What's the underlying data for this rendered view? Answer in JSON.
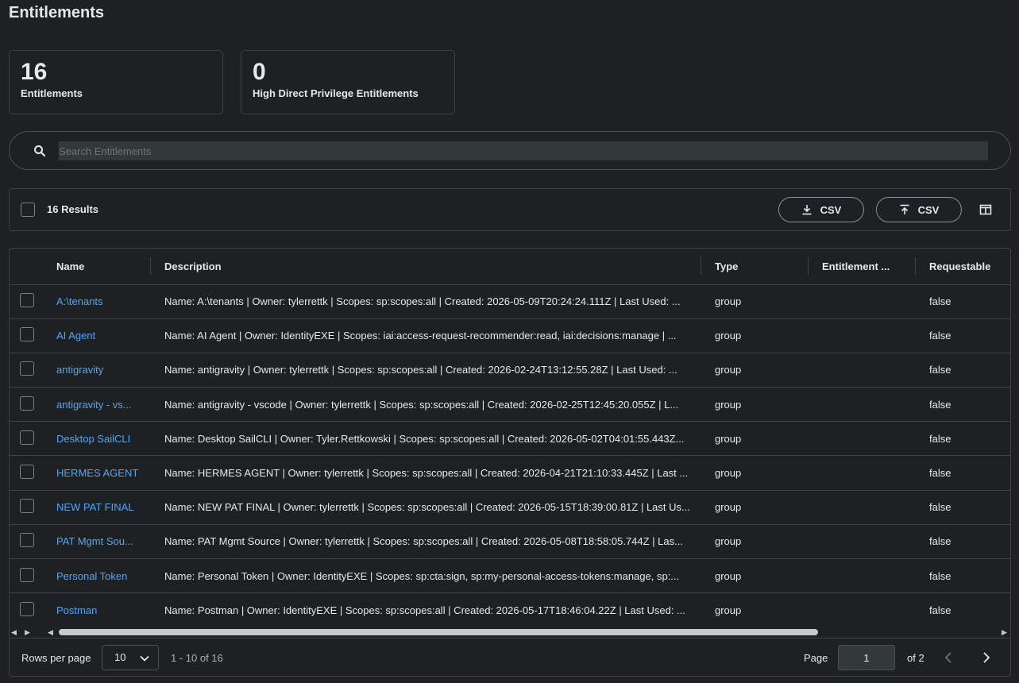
{
  "page": {
    "title": "Entitlements"
  },
  "stats": [
    {
      "value": "16",
      "label": "Entitlements"
    },
    {
      "value": "0",
      "label": "High Direct Privilege Entitlements"
    }
  ],
  "search": {
    "placeholder": "Search Entitlements",
    "value": ""
  },
  "toolbar": {
    "results_label": "16 Results",
    "download_csv_label": "CSV",
    "upload_csv_label": "CSV"
  },
  "table": {
    "columns": [
      "Name",
      "Description",
      "Type",
      "Entitlement ...",
      "Requestable"
    ],
    "rows": [
      {
        "name": "A:\\tenants",
        "description": "Name: A:\\tenants | Owner: tylerrettk | Scopes: sp:scopes:all | Created: 2026-05-09T20:24:24.111Z | Last Used: ...",
        "type": "group",
        "entitlement": "",
        "requestable": "false"
      },
      {
        "name": "AI Agent",
        "description": "Name: AI Agent | Owner: IdentityEXE | Scopes: iai:access-request-recommender:read, iai:decisions:manage | ...",
        "type": "group",
        "entitlement": "",
        "requestable": "false"
      },
      {
        "name": "antigravity",
        "description": "Name: antigravity | Owner: tylerrettk | Scopes: sp:scopes:all | Created: 2026-02-24T13:12:55.28Z | Last Used: ...",
        "type": "group",
        "entitlement": "",
        "requestable": "false"
      },
      {
        "name": "antigravity - vs...",
        "description": "Name: antigravity - vscode | Owner: tylerrettk | Scopes: sp:scopes:all | Created: 2026-02-25T12:45:20.055Z | L...",
        "type": "group",
        "entitlement": "",
        "requestable": "false"
      },
      {
        "name": "Desktop SailCLI",
        "description": "Name: Desktop SailCLI | Owner: Tyler.Rettkowski | Scopes: sp:scopes:all | Created: 2026-05-02T04:01:55.443Z...",
        "type": "group",
        "entitlement": "",
        "requestable": "false"
      },
      {
        "name": "HERMES AGENT",
        "description": "Name: HERMES AGENT | Owner: tylerrettk | Scopes: sp:scopes:all | Created: 2026-04-21T21:10:33.445Z | Last ...",
        "type": "group",
        "entitlement": "",
        "requestable": "false"
      },
      {
        "name": "NEW PAT FINAL",
        "description": "Name: NEW PAT FINAL | Owner: tylerrettk | Scopes: sp:scopes:all | Created: 2026-05-15T18:39:00.81Z | Last Us...",
        "type": "group",
        "entitlement": "",
        "requestable": "false"
      },
      {
        "name": "PAT Mgmt Sou...",
        "description": "Name: PAT Mgmt Source | Owner: tylerrettk | Scopes: sp:scopes:all | Created: 2026-05-08T18:58:05.744Z | Las...",
        "type": "group",
        "entitlement": "",
        "requestable": "false"
      },
      {
        "name": "Personal Token",
        "description": "Name: Personal Token | Owner: IdentityEXE | Scopes: sp:cta:sign, sp:my-personal-access-tokens:manage, sp:...",
        "type": "group",
        "entitlement": "",
        "requestable": "false"
      },
      {
        "name": "Postman",
        "description": "Name: Postman | Owner: IdentityEXE | Scopes: sp:scopes:all | Created: 2026-05-17T18:46:04.22Z | Last Used: ...",
        "type": "group",
        "entitlement": "",
        "requestable": "false"
      }
    ]
  },
  "pagination": {
    "rows_per_page_label": "Rows per page",
    "rows_per_page_value": "10",
    "range_label": "1 - 10 of 16",
    "page_label": "Page",
    "current_page": "1",
    "total_label": "of 2"
  },
  "icons": {
    "search": "search-icon",
    "download": "download-icon",
    "upload": "upload-icon",
    "columns": "columns-icon",
    "sort": "sort-icon",
    "chevron_down": "chevron-down-icon",
    "prev": "chevron-left-icon",
    "next": "chevron-right-icon"
  },
  "colors": {
    "background": "#1d2124",
    "link": "#5aa3f0",
    "border": "#3c4246"
  }
}
